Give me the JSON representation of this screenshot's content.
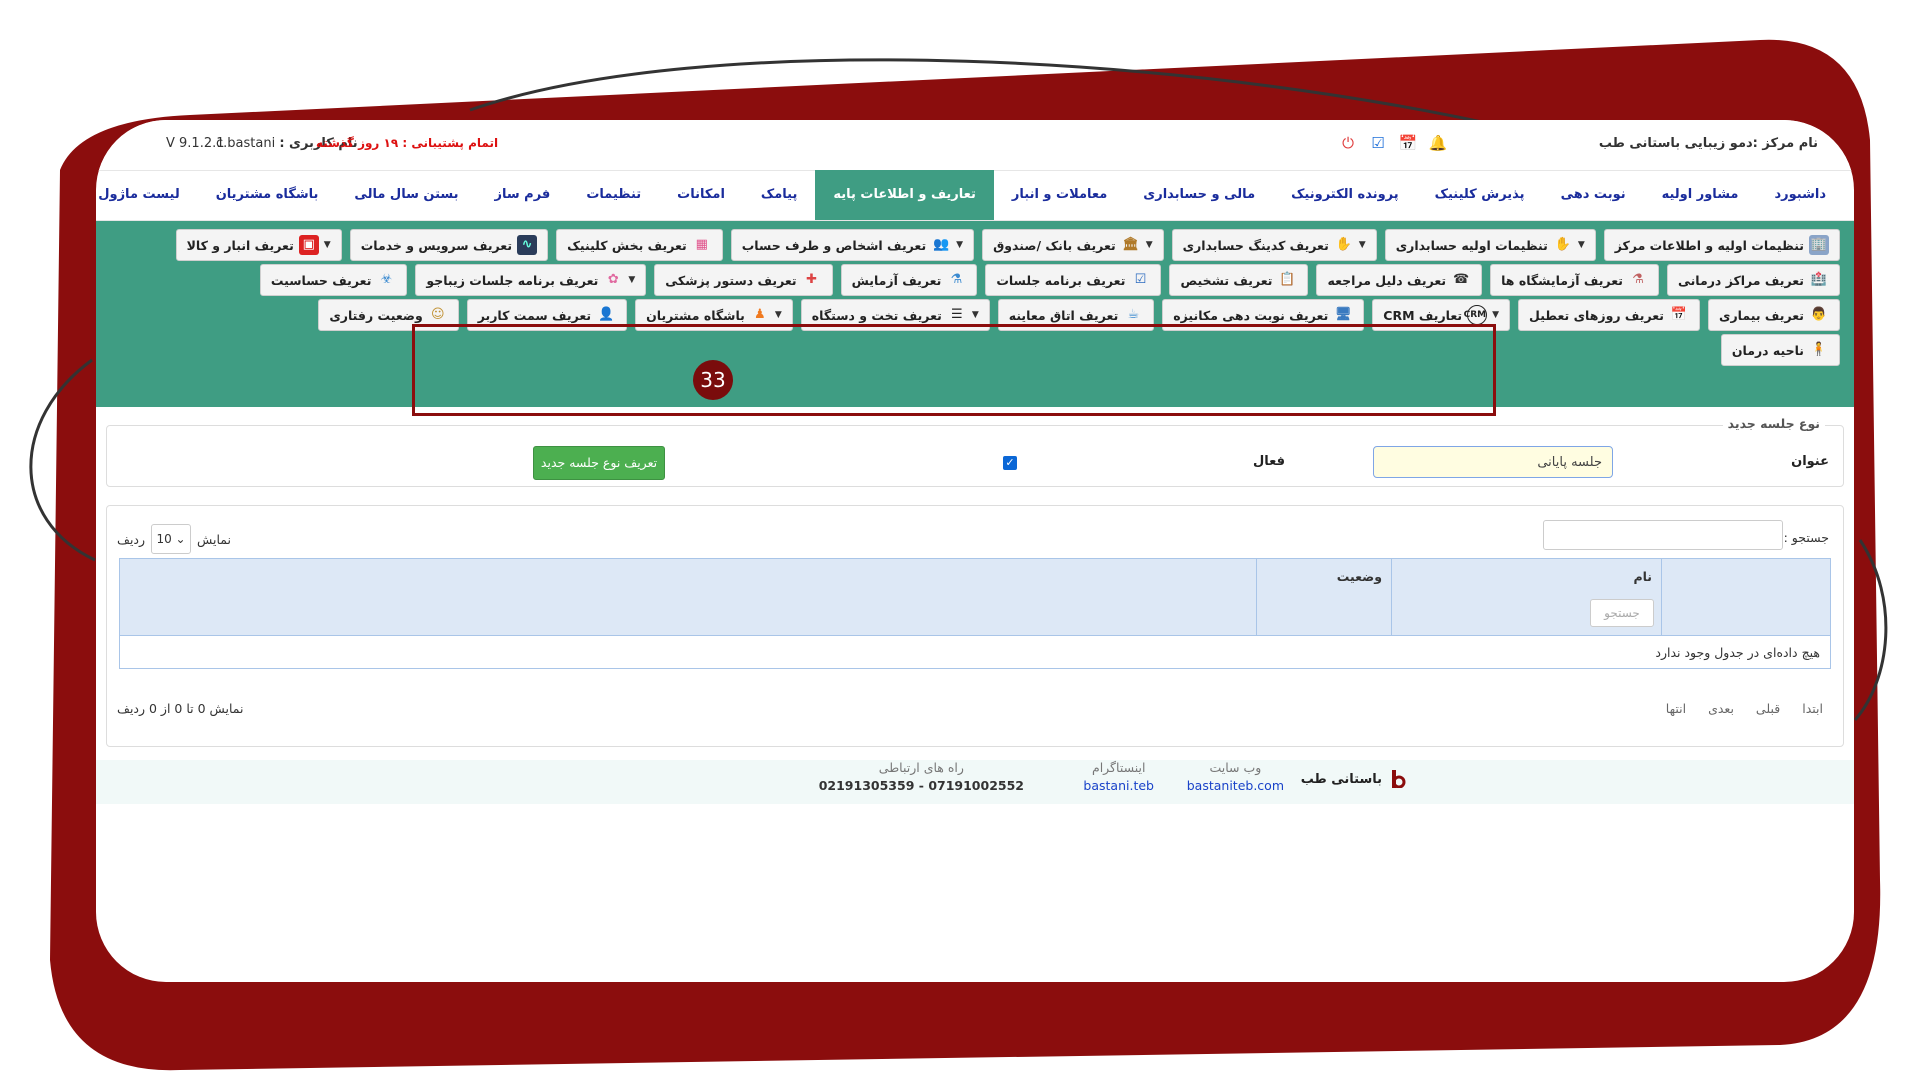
{
  "brand_color": "#8b0d0d",
  "accent_color": "#3f9d83",
  "topbar": {
    "center_name": "نام مرکز :دمو زیبایی باستانی طب",
    "user_label": "نام کاربری :",
    "user_value": "c.bastani",
    "support_label": "اتمام پشتیبانی :",
    "support_value": "۱۹ روز گذشته",
    "version": "V 9.1.2.1",
    "icons": [
      "bell-icon",
      "calendar-icon",
      "calendar-check-icon",
      "power-icon"
    ]
  },
  "nav": {
    "items": [
      "داشبورد",
      "مشاور اولیه",
      "نوبت دهی",
      "پذیرش کلینیک",
      "پرونده الکترونیک",
      "مالی و حسابداری",
      "معاملات و انبار",
      "تعاریف و اطلاعات پایه",
      "پیامک",
      "امکانات",
      "تنظیمات",
      "فرم ساز",
      "بستن سال مالی",
      "باشگاه مشتریان",
      "لیست ماژول ها"
    ],
    "active": "تعاریف و اطلاعات پایه"
  },
  "toolbar": {
    "row1": [
      {
        "label": "تنظیمات اولیه و اطلاعات مرکز",
        "icon": "building-icon",
        "dropdown": false
      },
      {
        "label": "تنظیمات اولیه حسابداری",
        "icon": "hand-icon",
        "dropdown": true
      },
      {
        "label": "تعریف کدینگ حسابداری",
        "icon": "hand-coin-icon",
        "dropdown": true
      },
      {
        "label": "تعریف بانک /صندوق",
        "icon": "bank-icon",
        "dropdown": true
      },
      {
        "label": "تعریف اشخاص و طرف حساب",
        "icon": "people-icon",
        "dropdown": true
      },
      {
        "label": "تعریف بخش کلینیک",
        "icon": "grid-icon",
        "dropdown": false
      },
      {
        "label": "تعریف سرویس و خدمات",
        "icon": "monitor-icon",
        "dropdown": false
      },
      {
        "label": "تعریف انبار و کالا",
        "icon": "box-icon",
        "dropdown": true
      }
    ],
    "row2": [
      {
        "label": "تعریف مراکز درمانی",
        "icon": "hospital-icon",
        "dropdown": false
      },
      {
        "label": "تعریف آزمایشگاه ها",
        "icon": "lab-icon",
        "dropdown": false
      },
      {
        "label": "تعریف دلیل مراجعه",
        "icon": "headset-icon",
        "dropdown": false
      },
      {
        "label": "تعریف تشخیص",
        "icon": "clipboard-icon",
        "dropdown": false
      },
      {
        "label": "تعریف برنامه جلسات",
        "icon": "checklist-icon",
        "dropdown": false
      },
      {
        "label": "تعریف آزمایش",
        "icon": "flask-icon",
        "dropdown": false
      },
      {
        "label": "تعریف دستور پزشکی",
        "icon": "prescription-icon",
        "dropdown": false
      },
      {
        "label": "تعریف برنامه جلسات زیباجو",
        "icon": "beauty-icon",
        "dropdown": true
      },
      {
        "label": "تعریف حساسیت",
        "icon": "allergy-icon",
        "dropdown": false
      }
    ],
    "row3": [
      {
        "label": "تعریف بیماری",
        "icon": "doctor-icon",
        "dropdown": false
      },
      {
        "label": "تعریف روزهای تعطیل",
        "icon": "calendar-icon",
        "dropdown": false
      },
      {
        "label": "تعاریف CRM",
        "icon": "crm-icon",
        "dropdown": true
      },
      {
        "label": "تعریف نوبت دهی مکانیزه",
        "icon": "computer-icon",
        "dropdown": false
      },
      {
        "label": "تعریف اتاق معاینه",
        "icon": "room-icon",
        "dropdown": false
      },
      {
        "label": "تعریف تخت و دستگاه",
        "icon": "list-icon",
        "dropdown": true
      },
      {
        "label": "باشگاه مشتریان",
        "icon": "group-icon",
        "dropdown": true
      },
      {
        "label": "تعریف سمت کاربر",
        "icon": "user-icon",
        "dropdown": false
      },
      {
        "label": "وضعیت رفتاری",
        "icon": "behavior-icon",
        "dropdown": false
      }
    ],
    "row4": [
      {
        "label": "ناحیه درمان",
        "icon": "body-icon",
        "dropdown": false
      }
    ]
  },
  "form": {
    "legend": "نوع جلسه جدید",
    "title_label": "عنوان",
    "title_value": "جلسه پایانی",
    "active_label": "فعال",
    "active_checked": true,
    "submit_label": "تعریف نوع جلسه جدید",
    "step_badge": "33"
  },
  "list": {
    "search_label": "جستجو :",
    "show_prefix": "نمایش",
    "show_value": "10",
    "show_suffix": "ردیف",
    "columns": [
      "نام",
      "وضعیت"
    ],
    "column_search_placeholder": "جستجو",
    "empty_text": "هیچ داده‌ای در جدول وجود ندارد",
    "info_text": "نمایش 0 تا 0 از 0 ردیف",
    "pager": [
      "ابتدا",
      "قبلی",
      "بعدی",
      "انتها"
    ]
  },
  "footer": {
    "brand": "باستانی طب",
    "website_title": "وب سایت",
    "website_value": "bastaniteb.com",
    "instagram_title": "اینستاگرام",
    "instagram_value": "bastani.teb",
    "contact_title": "راه های ارتباطی",
    "contact_value": "07191002552 - 02191305359"
  }
}
